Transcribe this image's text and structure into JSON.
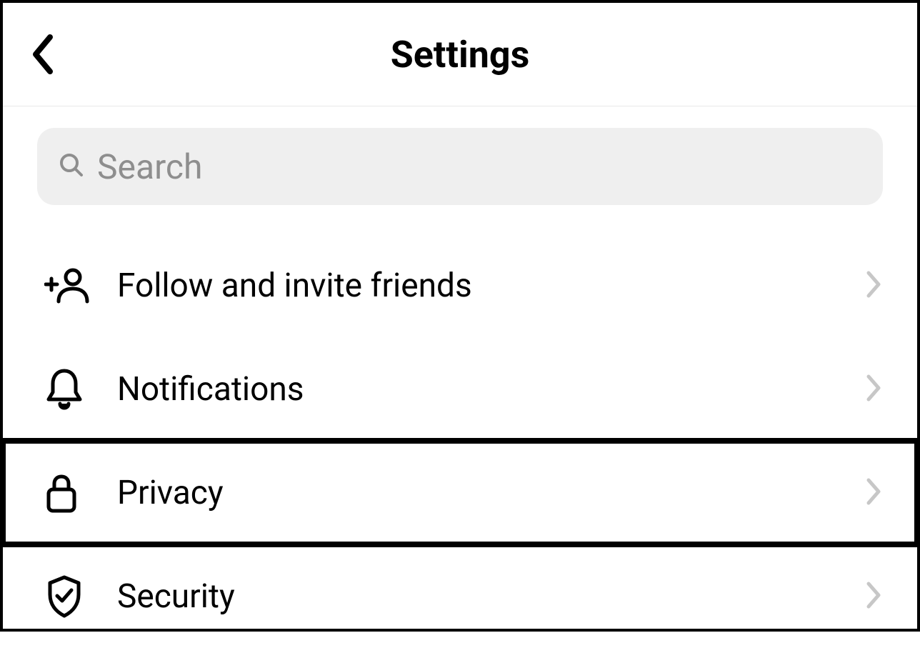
{
  "header": {
    "title": "Settings"
  },
  "search": {
    "placeholder": "Search"
  },
  "menu": {
    "items": [
      {
        "icon": "add-person-icon",
        "label": "Follow and invite friends",
        "highlighted": false
      },
      {
        "icon": "bell-icon",
        "label": "Notifications",
        "highlighted": false
      },
      {
        "icon": "lock-icon",
        "label": "Privacy",
        "highlighted": true
      },
      {
        "icon": "shield-check-icon",
        "label": "Security",
        "highlighted": false
      }
    ]
  }
}
